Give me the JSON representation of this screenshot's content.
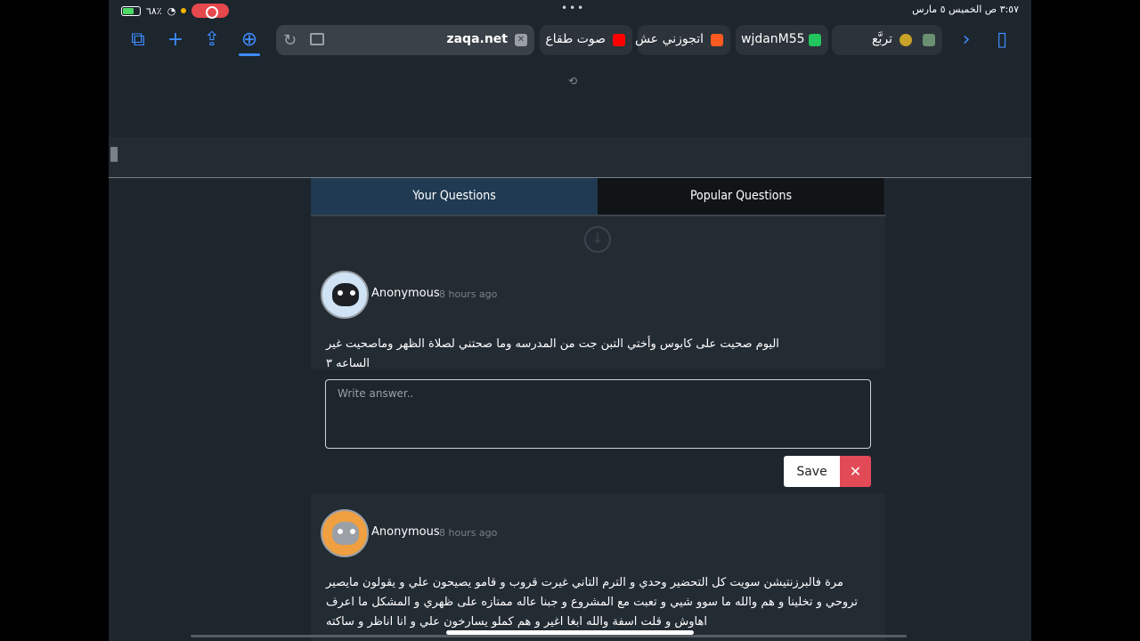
{
  "status": {
    "battery": "٦٨٪",
    "time_date": "٣:٥٧ ص   الخميس ٥ مارس",
    "dots": "•••"
  },
  "toolbar": {
    "url": "zaqa.net",
    "tabs": [
      {
        "label": "صوت طقاع",
        "fav_color": "#ff0000"
      },
      {
        "label": "اتجوزني عش",
        "fav_color": "#ff5a1f"
      },
      {
        "label": "wjdanM55",
        "fav_color": "#22c55e"
      },
      {
        "label": "تربَّع",
        "fav_color": "#c9a227"
      }
    ]
  },
  "qa": {
    "tab_your": "Your Questions",
    "tab_popular": "Popular Questions",
    "questions": [
      {
        "author": "Anonymous",
        "time": "8 hours ago",
        "text": "اليوم صحيت على كابوس وأختي التبن جت من المدرسه وما صحتني لصلاة الظهر وماصحيت غير الساعه ٣"
      },
      {
        "author": "Anonymous",
        "time": "8 hours ago",
        "text": "مرة فالبرزنتيشن سويت كل التحضير وحدي و الترم التاني غيرت قروب و قامو يصيحون علي و يقولون مايصير تروحي و تخلينا و هم والله ما سوو شيي و تعبت مع المشروع و جبنا عاله ممتازه على ظهري و المشكل ما اعرف اهاوش و قلت اسفة والله ابغا اغير و هم كملو يسارخون علي و انا اناظر و ساكته"
      }
    ],
    "answer_placeholder": "Write answer..",
    "save_label": "Save",
    "cancel_symbol": "✕"
  }
}
